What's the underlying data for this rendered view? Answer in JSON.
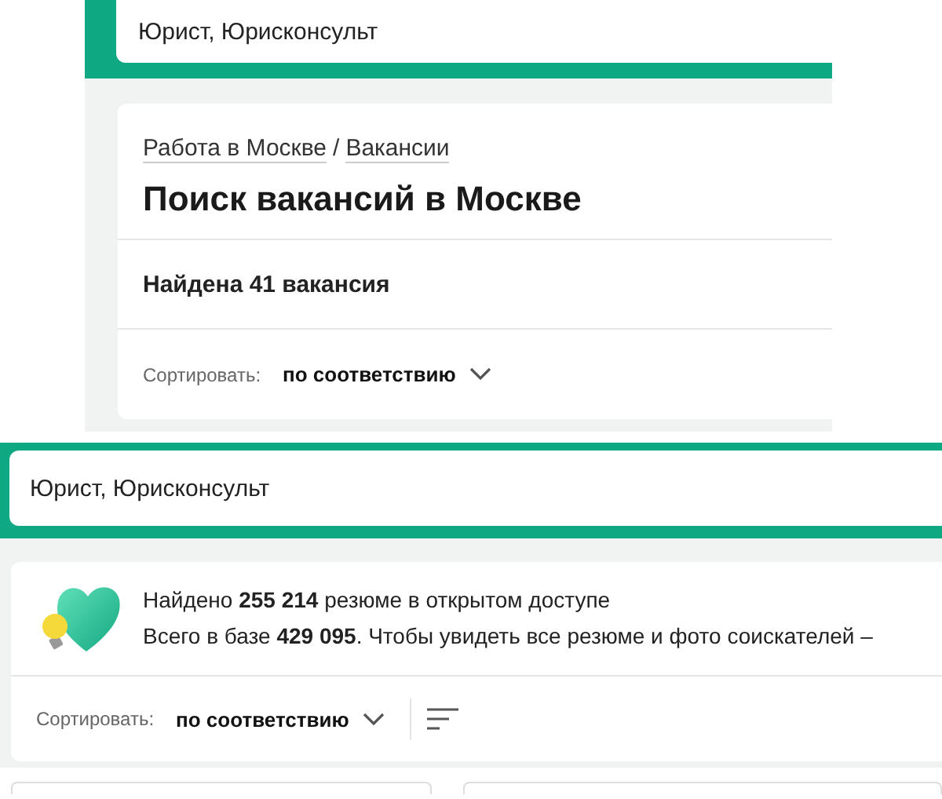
{
  "vacancy_panel": {
    "search": {
      "value": "Юрист, Юрисконсульт"
    },
    "breadcrumbs": [
      "Работа в Москве",
      "Вакансии"
    ],
    "breadcrumb_separator": "/",
    "title": "Поиск вакансий в Москве",
    "found": "Найдена 41 вакансия",
    "sort": {
      "label": "Сортировать:",
      "value": "по соответствию"
    }
  },
  "resume_panel": {
    "search": {
      "value": "Юрист, Юрисконсульт"
    },
    "info_lines": [
      "Найдено **255 214** резюме в открытом доступе",
      "Всего в базе **429 095**. Чтобы увидеть все резюме и фото соискателей –"
    ],
    "sort": {
      "label": "Сортировать:",
      "value": "по соответствию"
    }
  }
}
